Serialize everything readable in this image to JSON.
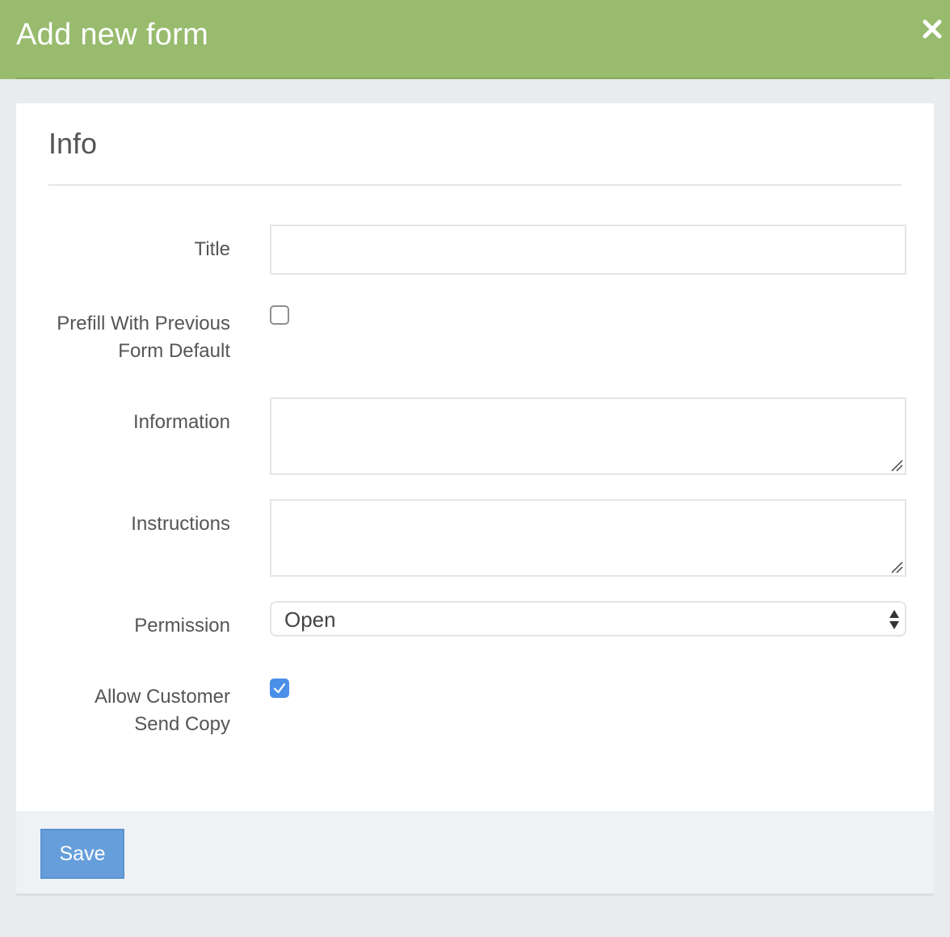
{
  "modal": {
    "title": "Add new form",
    "close_icon": "close-icon"
  },
  "section": {
    "title": "Info"
  },
  "fields": {
    "title": {
      "label": "Title",
      "value": "",
      "placeholder": ""
    },
    "prefill": {
      "label_line1": "Prefill With Previous",
      "label_line2": "Form Default",
      "checked": false
    },
    "information": {
      "label": "Information",
      "value": ""
    },
    "instructions": {
      "label": "Instructions",
      "value": ""
    },
    "permission": {
      "label": "Permission",
      "selected": "Open"
    },
    "allow_send_copy": {
      "label_line1": "Allow Customer",
      "label_line2": "Send Copy",
      "checked": true
    }
  },
  "footer": {
    "save_label": "Save"
  },
  "colors": {
    "header_bg": "#98bb6e",
    "save_button": "#669edb",
    "checkbox_checked": "#4a8fe8"
  }
}
